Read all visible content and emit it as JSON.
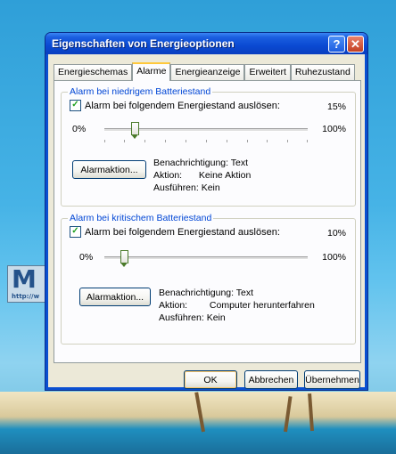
{
  "window": {
    "title": "Eigenschaften von Energieoptionen",
    "help": "?",
    "close": "✕"
  },
  "tabs": [
    "Energieschemas",
    "Alarme",
    "Energieanzeige",
    "Erweitert",
    "Ruhezustand"
  ],
  "low": {
    "group_title": "Alarm bei niedrigem Batteriestand",
    "checkbox_label": "Alarm bei folgendem Energiestand auslösen:",
    "checked": true,
    "percent": "15%",
    "min": "0%",
    "max": "100%",
    "level": 0.15,
    "button": "Alarmaktion...",
    "notif_k": "Benachrichtigung:",
    "notif_v": "Text",
    "action_k": "Aktion:",
    "action_v": "Keine Aktion",
    "run_k": "Ausführen:",
    "run_v": "Kein"
  },
  "critical": {
    "group_title": "Alarm bei kritischem Batteriestand",
    "checkbox_label": "Alarm bei folgendem Energiestand auslösen:",
    "checked": true,
    "percent": "10%",
    "min": "0%",
    "max": "100%",
    "level": 0.1,
    "button": "Alarmaktion...",
    "notif_k": "Benachrichtigung:",
    "notif_v": "Text",
    "action_k": "Aktion:",
    "action_v": "Computer herunterfahren",
    "run_k": "Ausführen:",
    "run_v": "Kein"
  },
  "buttons": {
    "ok": "OK",
    "cancel": "Abbrechen",
    "apply": "Übernehmen"
  },
  "desktop": {
    "logo": "M",
    "logo_sub": "http://w"
  }
}
